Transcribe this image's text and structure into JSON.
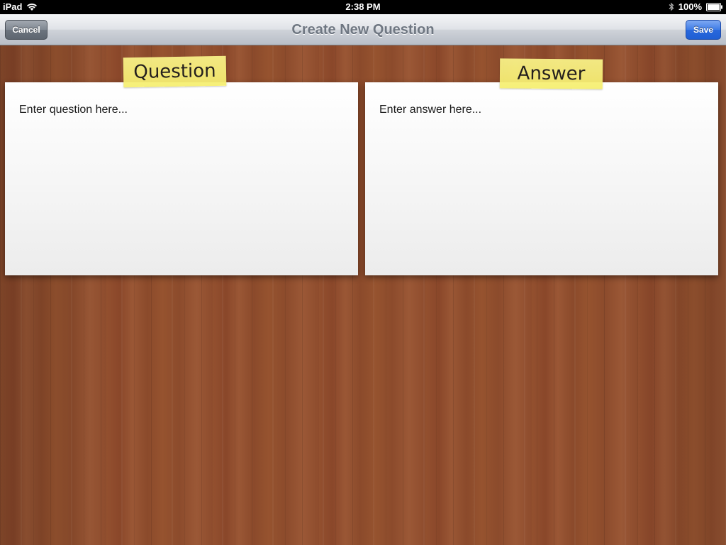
{
  "status_bar": {
    "device": "iPad",
    "time": "2:38 PM",
    "battery": "100%",
    "icons": [
      "wifi-icon",
      "bluetooth-icon",
      "battery-icon"
    ]
  },
  "nav_bar": {
    "title": "Create New Question",
    "cancel_label": "Cancel",
    "save_label": "Save"
  },
  "question_card": {
    "label": "Question",
    "placeholder": "Enter question here..."
  },
  "answer_card": {
    "label": "Answer",
    "placeholder": "Enter answer here..."
  },
  "colors": {
    "save_button": "#2a68dc",
    "cancel_button": "#6c747e",
    "sticky_note": "#f6ee6e",
    "wood": "#8e4d30"
  }
}
